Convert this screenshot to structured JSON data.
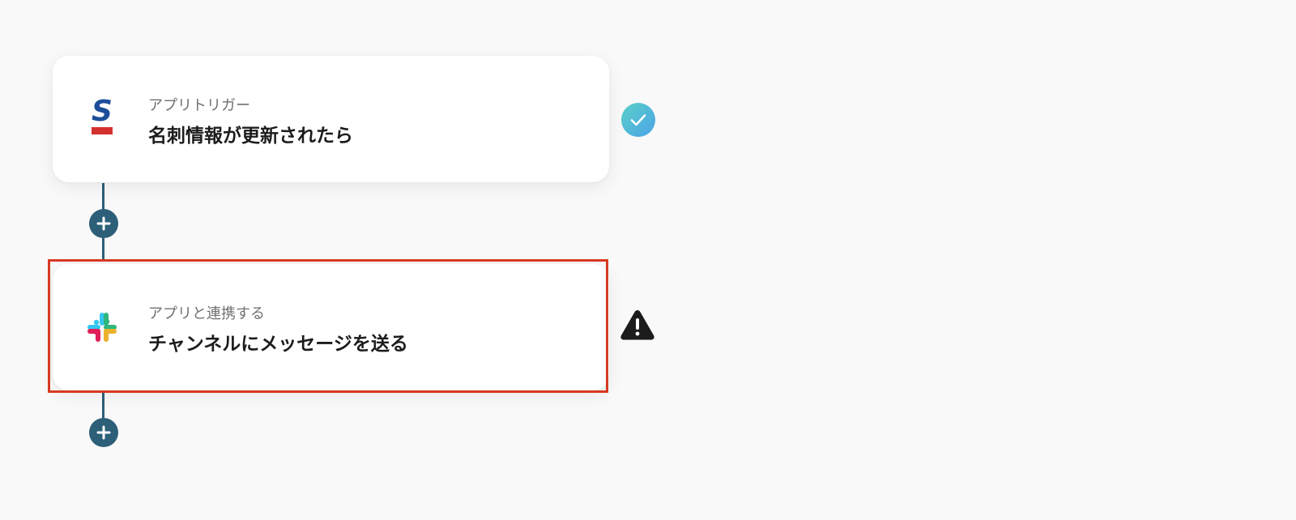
{
  "flow": {
    "trigger": {
      "subtitle": "アプリトリガー",
      "title": "名刺情報が更新されたら",
      "app_icon": "sansan-logo-icon",
      "status_icon": "check-icon",
      "status": "configured"
    },
    "action": {
      "subtitle": "アプリと連携する",
      "title": "チャンネルにメッセージを送る",
      "app_icon": "slack-logo-icon",
      "status_icon": "warning-icon",
      "status": "incomplete",
      "highlighted": true
    },
    "add_step_icon": "plus-icon"
  },
  "colors": {
    "background": "#f9f9f9",
    "connector": "#2d5f78",
    "highlight": "#d63a23",
    "check_gradient_start": "#5bd1c8",
    "check_gradient_end": "#4aa3e8",
    "warning": "#1c1c1c"
  }
}
